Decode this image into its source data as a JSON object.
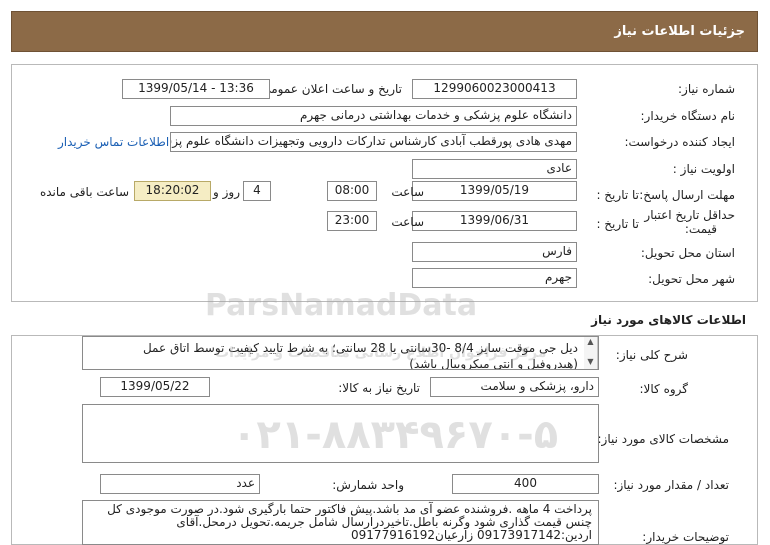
{
  "header": {
    "title": "جزئیات اطلاعات نیاز"
  },
  "form": {
    "need_number_label": "شماره نیاز:",
    "need_number": "1299060023000413",
    "announce_label": "تاریخ و ساعت اعلان عمومی:",
    "announce_value": "1399/05/14 - 13:36",
    "buyer_org_label": "نام دستگاه خریدار:",
    "buyer_org": "دانشگاه علوم پزشکی و خدمات بهداشتی درمانی جهرم",
    "creator_label": "ایجاد کننده درخواست:",
    "creator": "مهدی هادی پورقطب آبادی کارشناس تدارکات دارویی وتجهیزات دانشگاه علوم پزشکی",
    "contact_link": "اطلاعات تماس خریدار",
    "priority_label": "اولویت نیاز :",
    "priority": "عادی",
    "reply_deadline_label": "مهلت ارسال پاسخ:",
    "until_date_label": "تا تاریخ :",
    "reply_date": "1399/05/19",
    "time_label": "ساعت",
    "reply_time": "08:00",
    "days_value": "4",
    "days_label": "روز و",
    "remaining_time": "18:20:02",
    "remaining_label": "ساعت باقی مانده",
    "validity_label_1": "حداقل تاریخ اعتبار",
    "validity_label_2": "قیمت:",
    "validity_date": "1399/06/31",
    "validity_time": "23:00",
    "province_label": "استان محل تحویل:",
    "province": "فارس",
    "city_label": "شهر محل تحویل:",
    "city": "جهرم"
  },
  "goods": {
    "section_title": "اطلاعات کالاهای مورد نیاز",
    "description_label": "شرح کلی نیاز:",
    "description": "دیل جی موقت سایز 8/4 -30سانتی یا 28 سانتی؛ به شرط تایید کیفیت توسط اتاق عمل (هیدروفیل و انتی میکروبیال باشد)",
    "group_label": "گروه کالا:",
    "group": "دارو، پزشکی و سلامت",
    "need_date_label": "تاریخ نیاز به کالا:",
    "need_date": "1399/05/22",
    "specs_label": "مشخصات کالای مورد نیاز:",
    "specs": "",
    "quantity_label": "تعداد / مقدار مورد نیاز:",
    "quantity": "400",
    "unit_label": "واحد شمارش:",
    "unit": "عدد",
    "buyer_notes_label": "توضیحات خریدار:",
    "buyer_notes": "پرداخت 4 ماهه .فروشنده عضو آی مد باشد.پیش فاکتور حتما بارگیری شود.در صورت موجودی کل چنس قیمت گذاری شود وگرنه باطل.تاخیردرارسال شامل جریمه.تحویل درمحل.آقای اردین:09173917142 زارعیان09177916192"
  },
  "watermark": {
    "brand": "ParsNamadData",
    "subtitle": "مرکز فراخوان اطلاع رسانی مناقصات و مزایدات",
    "phone": "۰۲۱-۸۸۳۴۹۶۷۰-۵"
  },
  "colors": {
    "titlebar": "#8c6a47",
    "remaining_bg": "#f5edc4",
    "link": "#1a5fb4"
  }
}
